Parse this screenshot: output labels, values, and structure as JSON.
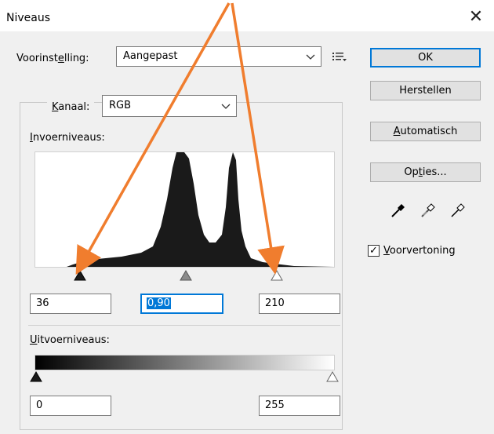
{
  "window": {
    "title": "Niveaus",
    "close_glyph": "✕"
  },
  "preset": {
    "label_pre": "Voorinst",
    "label_acc": "e",
    "label_post": "lling:",
    "value": "Aangepast"
  },
  "channel": {
    "label_acc": "K",
    "label_post": "anaal:",
    "value": "RGB"
  },
  "input_levels": {
    "label_acc": "I",
    "label_post": "nvoerniveaus:",
    "black": "36",
    "gamma": "0,90",
    "white": "210",
    "black_fraction": 0.141,
    "gamma_value": 0.9,
    "white_fraction": 0.824
  },
  "output_levels": {
    "label_acc": "U",
    "label_post": "itvoerniveaus:",
    "black": "0",
    "white": "255",
    "black_fraction": 0.0,
    "white_fraction": 1.0
  },
  "buttons": {
    "ok": "OK",
    "reset": "Herstellen",
    "auto_acc": "A",
    "auto_post": "utomatisch",
    "options_pre": "Op",
    "options_acc": "t",
    "options_post": "ies..."
  },
  "preview": {
    "checked": true,
    "label_acc": "V",
    "label_post": "oorvertoning"
  },
  "icons": [
    "preset-menu-icon",
    "black-eyedropper-icon",
    "gray-eyedropper-icon",
    "white-eyedropper-icon",
    "chevron-down-icon"
  ],
  "colors": {
    "accent": "#0078d7",
    "arrow": "#f07d2e"
  }
}
